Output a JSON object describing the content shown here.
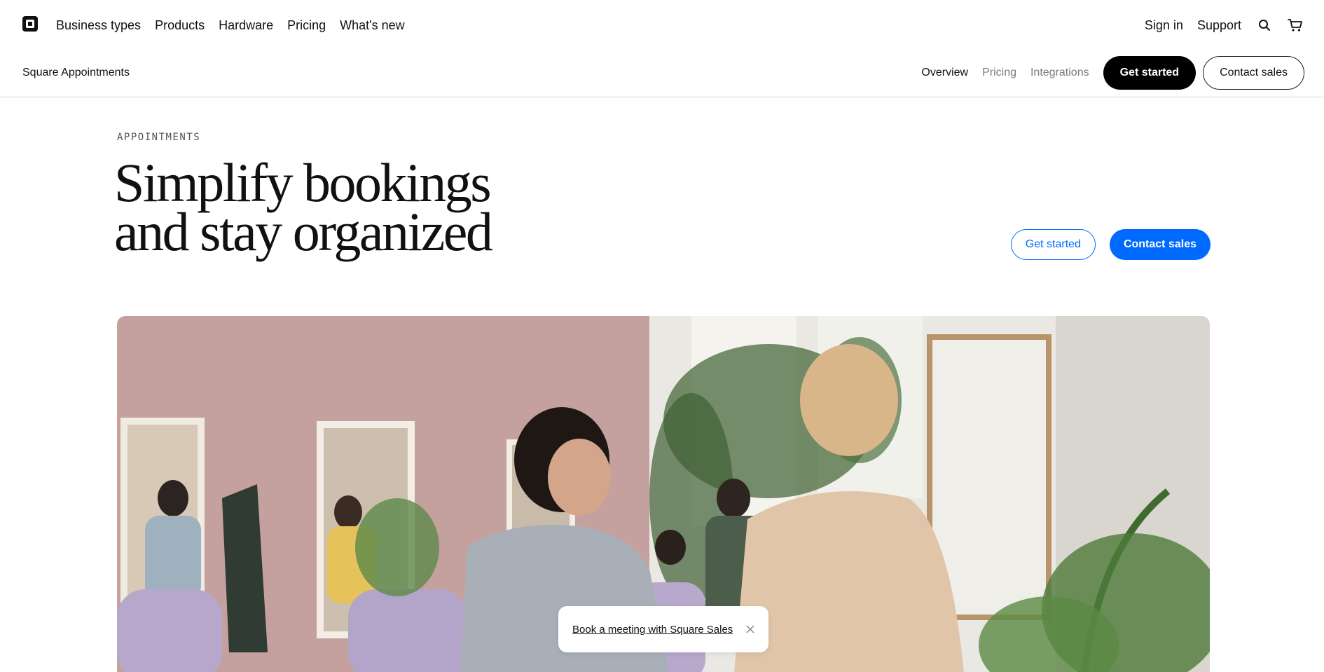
{
  "top_nav": {
    "primary": [
      "Business types",
      "Products",
      "Hardware",
      "Pricing",
      "What's new"
    ],
    "sign_in": "Sign in",
    "support": "Support",
    "icons": {
      "logo": "square-logo-icon",
      "search": "search-icon",
      "cart": "cart-icon"
    }
  },
  "sub_nav": {
    "product_name": "Square Appointments",
    "links": [
      {
        "label": "Overview",
        "state": "active"
      },
      {
        "label": "Pricing",
        "state": "inactive"
      },
      {
        "label": "Integrations",
        "state": "inactive"
      }
    ],
    "get_started": "Get started",
    "contact_sales": "Contact sales"
  },
  "hero": {
    "eyebrow": "APPOINTMENTS",
    "headline_line1": "Simplify bookings",
    "headline_line2": "and stay organized",
    "get_started": "Get started",
    "contact_sales": "Contact sales"
  },
  "toast": {
    "link": "Book a meeting with Square Sales",
    "close_icon": "close-icon"
  },
  "colors": {
    "accent_blue": "#006aff",
    "black": "#000000",
    "muted_text": "#7a7a7a",
    "divider": "#d8d8d8"
  }
}
